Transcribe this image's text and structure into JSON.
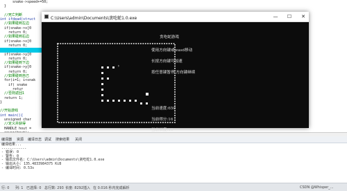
{
  "editor": {
    "lines": [
      {
        "text": "      snake->speed+=50;",
        "cls": "c-plain"
      },
      {
        "text": "  }",
        "cls": "c-plain"
      },
      {
        "text": "",
        "cls": "c-plain"
      },
      {
        "text": "  //死亡判断",
        "cls": "c-comment"
      },
      {
        "text": "int ifdead(struct",
        "cls": "c-kw"
      },
      {
        "text": "  //如果碰到左边",
        "cls": "c-comment"
      },
      {
        "text": "  if(snake->x[0",
        "cls": "c-plain"
      },
      {
        "text": "    return 0;",
        "cls": "c-plain"
      },
      {
        "text": "  //如果碰到右边",
        "cls": "c-comment"
      },
      {
        "text": "  if(snake->x[0",
        "cls": "c-plain"
      },
      {
        "text": "    return 0;",
        "cls": "c-plain"
      },
      {
        "text": "",
        "cls": "c-hl"
      },
      {
        "text": "  if(snake->y[0",
        "cls": "c-plain"
      },
      {
        "text": "    return 0;",
        "cls": "c-plain"
      },
      {
        "text": "  //如果碰到下边",
        "cls": "c-comment"
      },
      {
        "text": "  if(snake->y[0",
        "cls": "c-plain"
      },
      {
        "text": "    return 0;",
        "cls": "c-plain"
      },
      {
        "text": "  //如果碰到自己",
        "cls": "c-comment"
      },
      {
        "text": "  for(i=1; i<snak",
        "cls": "c-plain"
      },
      {
        "text": "    if( snake",
        "cls": "c-plain"
      },
      {
        "text": "      retur",
        "cls": "c-plain"
      },
      {
        "text": "  //否则返回1",
        "cls": "c-comment"
      },
      {
        "text": "  return 1;",
        "cls": "c-plain"
      },
      {
        "text": "}",
        "cls": "c-plain"
      },
      {
        "text": "",
        "cls": "c-plain"
      },
      {
        "text": "//开始游戏",
        "cls": "c-comment"
      },
      {
        "text": "int main(){",
        "cls": "c-kw"
      },
      {
        "text": "  unsigned char",
        "cls": "c-plain"
      },
      {
        "text": "  //定义并获得",
        "cls": "c-comment"
      },
      {
        "text": "  HANDLE hout =",
        "cls": "c-plain"
      },
      {
        "text": "  cover(hout);",
        "cls": "c-plain"
      },
      {
        "text": "  struct Snake",
        "cls": "c-plain"
      },
      {
        "text": "  struct Food f",
        "cls": "c-plain"
      }
    ]
  },
  "bottom_tabs": {
    "tab1": "编译器",
    "tab2": "资源",
    "tab3": "编译日志",
    "tab4": "调试",
    "tab5": "搜索结果",
    "tab6": "关闭"
  },
  "output": {
    "lines": [
      "编译结果...",
      "------------",
      "- 错误: 0",
      "- 警告: 0",
      "- 输出文件名: C:\\Users\\admin\\Documents\\贪吃蛇1.0.exe",
      "- 输出大小: 135.4833984375 KiB",
      "- 编译时间: 0.53s"
    ]
  },
  "statusbar": {
    "line": "行: 0",
    "col": "列: 1",
    "selected": "已选择: 0",
    "total": "总行数: 293",
    "length": "长度: 8292",
    "mode": "插入",
    "parse": "在 0.016 秒内完成解析",
    "watermark": "CSDN @Whisper_..."
  },
  "console": {
    "title": "C:\\Users\\admin\\Documents\\贪吃蛇1.0.exe",
    "minimize": "—",
    "maximize": "☐",
    "close": "✕",
    "game_title": "贪吃蛇游戏",
    "instructions": [
      "使用方向键或wasd移动",
      "长按方向键可加速",
      "按任意键暂停,方向键继续"
    ],
    "speed_label": "当前速度:650",
    "score_label": "当前得分:16",
    "length_label": "当前长度:19"
  },
  "colors": {
    "console_bg": "#0c0c0c",
    "highlight_line": "#00c8e6",
    "comment": "#008000"
  }
}
